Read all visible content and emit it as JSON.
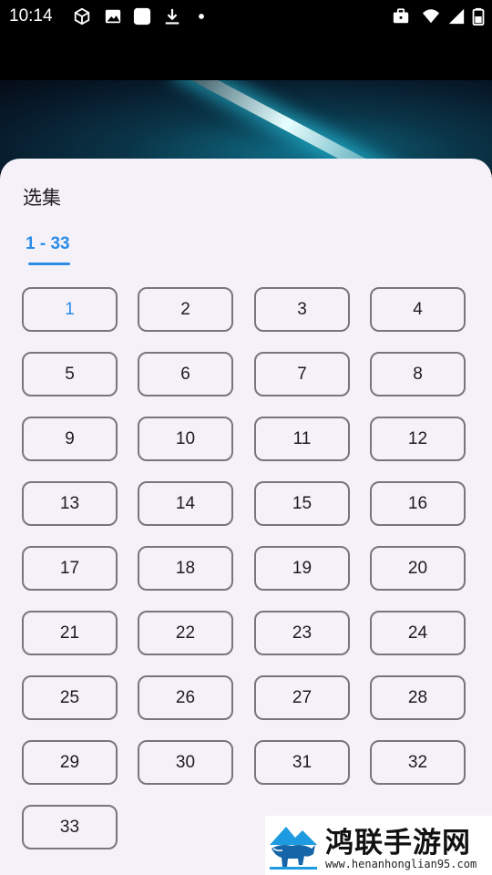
{
  "status_bar": {
    "time": "10:14",
    "left_icons": [
      "cube-icon",
      "image-icon",
      "square-icon",
      "download-icon",
      "dot-icon"
    ],
    "right_icons": [
      "briefcase-icon",
      "wifi-icon",
      "signal-icon",
      "battery-icon"
    ]
  },
  "sheet": {
    "title": "选集",
    "tab_label": "1 - 33",
    "accent_color": "#2b8ce6",
    "selected_episode": "1",
    "episodes": [
      "1",
      "2",
      "3",
      "4",
      "5",
      "6",
      "7",
      "8",
      "9",
      "10",
      "11",
      "12",
      "13",
      "14",
      "15",
      "16",
      "17",
      "18",
      "19",
      "20",
      "21",
      "22",
      "23",
      "24",
      "25",
      "26",
      "27",
      "28",
      "29",
      "30",
      "31",
      "32",
      "33"
    ]
  },
  "watermark": {
    "title": "鸿联手游网",
    "url": "www.henanhonglian95.com"
  }
}
